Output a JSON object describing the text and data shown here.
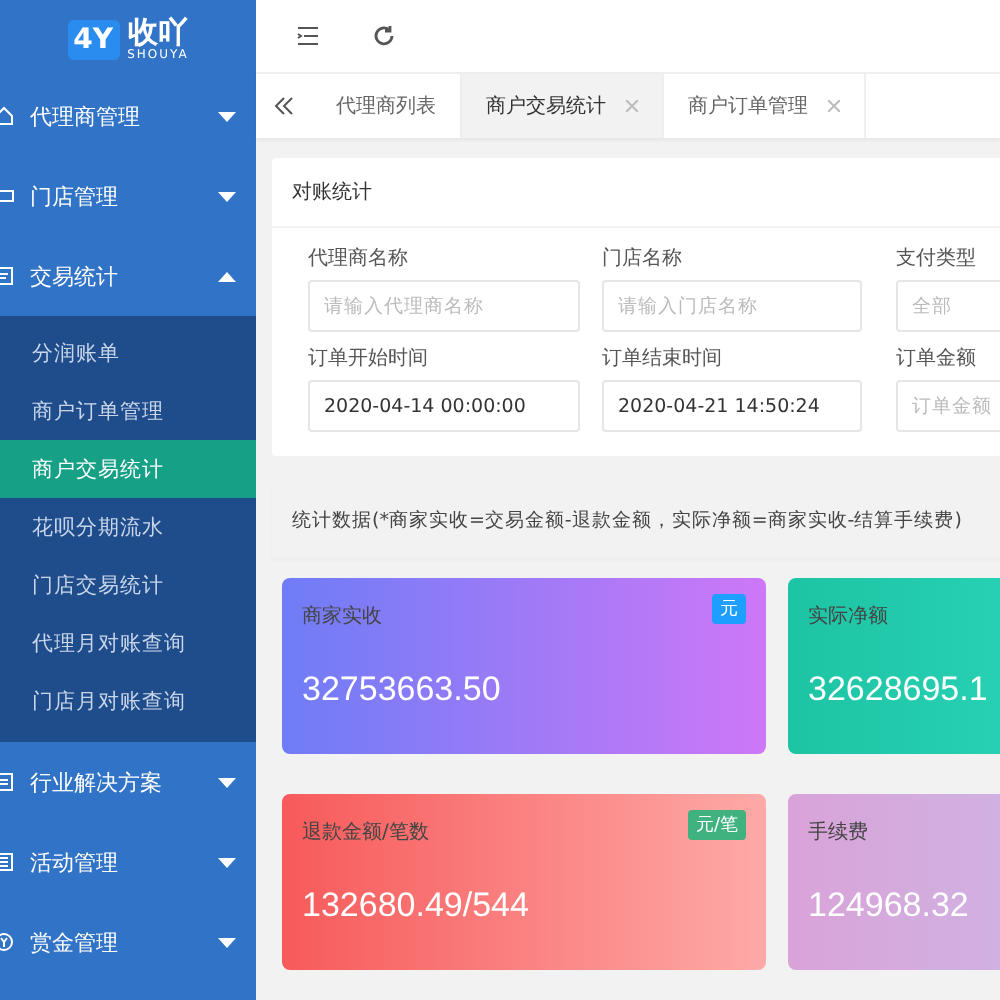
{
  "logo": {
    "mark": "4Y",
    "name": "收吖",
    "sub": "SHOUYA"
  },
  "sidebar": {
    "menu": [
      {
        "label": "代理商管理",
        "expanded": false
      },
      {
        "label": "门店管理",
        "expanded": false
      },
      {
        "label": "交易统计",
        "expanded": true,
        "children": [
          {
            "label": "分润账单",
            "selected": false
          },
          {
            "label": "商户订单管理",
            "selected": false
          },
          {
            "label": "商户交易统计",
            "selected": true
          },
          {
            "label": "花呗分期流水",
            "selected": false
          },
          {
            "label": "门店交易统计",
            "selected": false
          },
          {
            "label": "代理月对账查询",
            "selected": false
          },
          {
            "label": "门店月对账查询",
            "selected": false
          }
        ]
      },
      {
        "label": "行业解决方案",
        "expanded": false
      },
      {
        "label": "活动管理",
        "expanded": false
      },
      {
        "label": "赏金管理",
        "expanded": false
      }
    ]
  },
  "tabs": [
    {
      "label": "代理商列表",
      "selected": false,
      "closable": false
    },
    {
      "label": "商户交易统计",
      "selected": true,
      "closable": true
    },
    {
      "label": "商户订单管理",
      "selected": false,
      "closable": true
    }
  ],
  "filter": {
    "title": "对账统计",
    "fields": [
      {
        "label": "代理商名称",
        "placeholder": "请输入代理商名称"
      },
      {
        "label": "门店名称",
        "placeholder": "请输入门店名称"
      },
      {
        "label": "支付类型",
        "placeholder": "全部"
      },
      {
        "label": "订单开始时间",
        "value": "2020-04-14 00:00:00"
      },
      {
        "label": "订单结束时间",
        "value": "2020-04-21 14:50:24"
      },
      {
        "label": "订单金额",
        "placeholder": "订单金额"
      }
    ]
  },
  "stats_note": "统计数据(*商家实收=交易金额-退款金额，实际净额=商家实收-结算手续费)",
  "cards": [
    {
      "title": "商家实收",
      "value": "32753663.50",
      "badge": {
        "text": "元",
        "color": "#1e9fff"
      }
    },
    {
      "title": "实际净额",
      "value": "32628695.1"
    },
    {
      "title": "退款金额/笔数",
      "value": "132680.49/544",
      "badge": {
        "text": "元/笔",
        "color": "#3fb27f"
      }
    },
    {
      "title": "手续费",
      "value": "124968.32"
    }
  ]
}
